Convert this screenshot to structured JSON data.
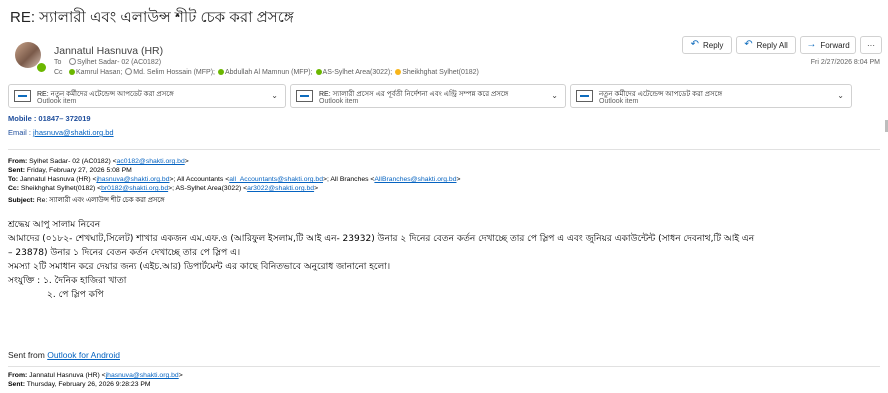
{
  "subject": "RE: স্যালারী এবং এলাউন্স শীট চেক করা প্রসঙ্গে",
  "sender": "Jannatul Hasnuva (HR)",
  "to_label": "To",
  "to_value": "Sylhet Sadar- 02 (AC0182)",
  "cc_label": "Cc",
  "cc_list": [
    {
      "name": "Kamrul Hasan;",
      "status": "on"
    },
    {
      "name": "Md. Selim Hossain (MFP);",
      "status": "off"
    },
    {
      "name": "Abdullah Al Mamnun (MFP);",
      "status": "on"
    },
    {
      "name": "AS-Sylhet Area(3022);",
      "status": "on"
    },
    {
      "name": "Sheikhghat Sylhet(0182)",
      "status": "away"
    }
  ],
  "actions": {
    "reply": "Reply",
    "reply_all": "Reply All",
    "forward": "Forward",
    "more": "···"
  },
  "date": "Fri 2/27/2026 8:04 PM",
  "attachments": [
    {
      "title": "RE: নতুন কর্মীদের এটেন্ডেন্স আপডেট করা প্রসঙ্গে",
      "sub": "Outlook item"
    },
    {
      "title": "RE: স্যালারী প্রসেস এর পূর্বতী নির্দেশনা এবং এন্ট্রি সম্পন্ন করে প্রসঙ্গে",
      "sub": "Outlook item"
    },
    {
      "title": "নতুন কর্মীদের এটেন্ডেন্স আপডেট করা প্রসঙ্গে",
      "sub": "Outlook item"
    }
  ],
  "signature": {
    "mobile": "Mobile : 01847– 372019",
    "email_label": "Email  :  ",
    "email": "jhasnuva@shakti.org.bd"
  },
  "header1": {
    "from_label": "From:",
    "from_text": " Sylhet Sadar- 02 (AC0182) <",
    "from_email": "ac0182@shakti.org.bd",
    "from_end": ">",
    "sent_label": "Sent:",
    "sent_text": " Friday, February 27, 2026 5:08 PM",
    "to_label": "To:",
    "to_t1": " Jannatul Hasnuva (HR) <",
    "to_e1": "jhasnuva@shakti.org.bd",
    "to_t2": ">; All Accountants <",
    "to_e2": "all_Accountants@shakti.org.bd",
    "to_t3": ">; All Branches <",
    "to_e3": "AllBranches@shakti.org.bd",
    "to_t4": ">",
    "cc_label": "Cc:",
    "cc_t1": " Sheikhghat Sylhet(0182) <",
    "cc_e1": "br0182@shakti.org.bd",
    "cc_t2": ">; AS-Sylhet Area(3022) <",
    "cc_e2": "ar3022@shakti.org.bd",
    "cc_t3": ">",
    "subject_label": "Subject:",
    "subject_text": " Re: স্যালারী এবং এলাউন্স শীট চেক করা প্রসঙ্গে"
  },
  "body_lines": [
    "শ্রদ্ধেয় আপু সালাম নিবেন",
    "আমাদের (০১৮২- শেখঘাট,সিলেট) শাখার একজন এম.এফ.ও (আরিফুল ইসলাম,টি আই এন- 23932) উনার ২ দিনের বেতন কর্তন দেখাচ্ছে তার পে স্লিপ এ এবং জুনিয়র একাউন্টেন্ট (সাধন দেবনাথ,টি আই এন",
    "– 23878) উনার ১ দিনের বেতন কর্তন দেখাচ্ছে তার পে স্লিপ এ।",
    "সমস্যা ২টি সমাধান করে দেয়ার জন্য (এইচ.আর) ডিপার্টমেন্ট এর কাছে বিনিতভাবে অনুরোধ জানানো হলো।",
    "সংযুক্তি :  ১. দৈনিক হাজিরা খাতা",
    "২. পে স্লিপ কপি"
  ],
  "sent_from": {
    "prefix": "Sent from ",
    "link": "Outlook for Android"
  },
  "header2": {
    "from_label": "From:",
    "from_text": " Jannatul Hasnuva (HR) <",
    "from_email": "jhasnuva@shakti.org.bd",
    "from_end": ">",
    "sent_label": "Sent:",
    "sent_text": " Thursday, February 26, 2026 9:28:23 PM"
  }
}
